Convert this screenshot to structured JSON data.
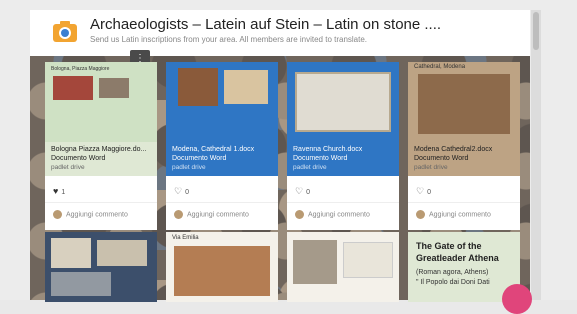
{
  "header": {
    "title": "Archaeologists – Latein auf Stein – Latin on stone ....",
    "subtitle": "Send us Latin inscriptions from your area. All members are invited to translate.",
    "menu_glyph": "⋮"
  },
  "cards": [
    {
      "title": "Bologna Piazza Maggiore.do...",
      "type": "Documento Word",
      "source": "padlet drive",
      "likes": "1",
      "liked": true,
      "comment_label": "Aggiungi commento",
      "image_caption": "Bologna, Piazza Maggiore"
    },
    {
      "title": "Modena, Cathedral 1.docx",
      "type": "Documento Word",
      "source": "padlet drive",
      "likes": "0",
      "liked": false,
      "comment_label": "Aggiungi commento",
      "image_caption": ""
    },
    {
      "title": "Ravenna Church.docx",
      "type": "Documento Word",
      "source": "padlet drive",
      "likes": "0",
      "liked": false,
      "comment_label": "Aggiungi commento",
      "image_caption": ""
    },
    {
      "title": "Modena Cathedral2.docx",
      "type": "Documento Word",
      "source": "padlet drive",
      "likes": "0",
      "liked": false,
      "comment_label": "Aggiungi commento",
      "image_caption": "Cathedral, Modena"
    }
  ],
  "bottom_cards": [
    {
      "caption": ""
    },
    {
      "caption": "Via Emilia"
    },
    {
      "caption": ""
    }
  ],
  "text_card": {
    "line1": "The Gate of the",
    "line2": "Greatleader Athena",
    "line3": "(Roman agora, Athens)",
    "line4": "\" Il Popolo dai Doni Dati"
  },
  "icons": {
    "like": "heart-icon",
    "camera": "camera-icon"
  },
  "colors": {
    "blue_card": "#2f76c4",
    "tan_card": "#bda384",
    "green_card": "#dfe8d4",
    "fab": "#e0457b"
  }
}
